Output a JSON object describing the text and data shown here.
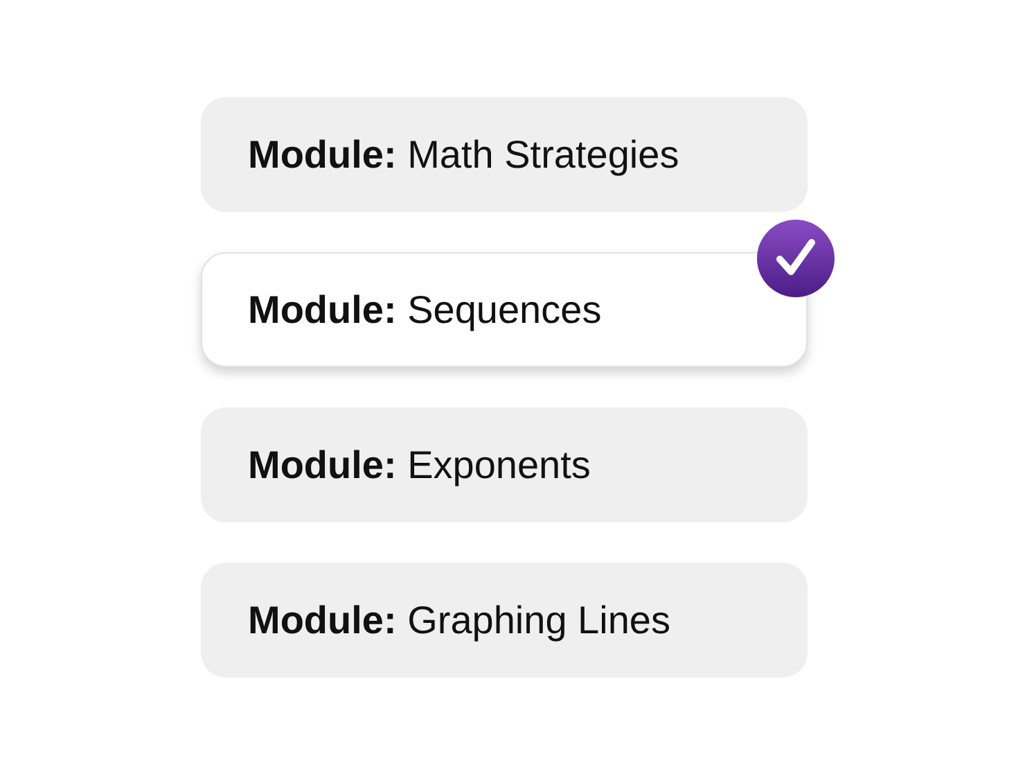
{
  "modules": [
    {
      "label": "**Module:** Math Strategies",
      "selected": false
    },
    {
      "label": "**Module:** Sequences",
      "selected": true
    },
    {
      "label": "**Module:** Exponents",
      "selected": false
    },
    {
      "label": "**Module:** Graphing Lines",
      "selected": false
    }
  ]
}
